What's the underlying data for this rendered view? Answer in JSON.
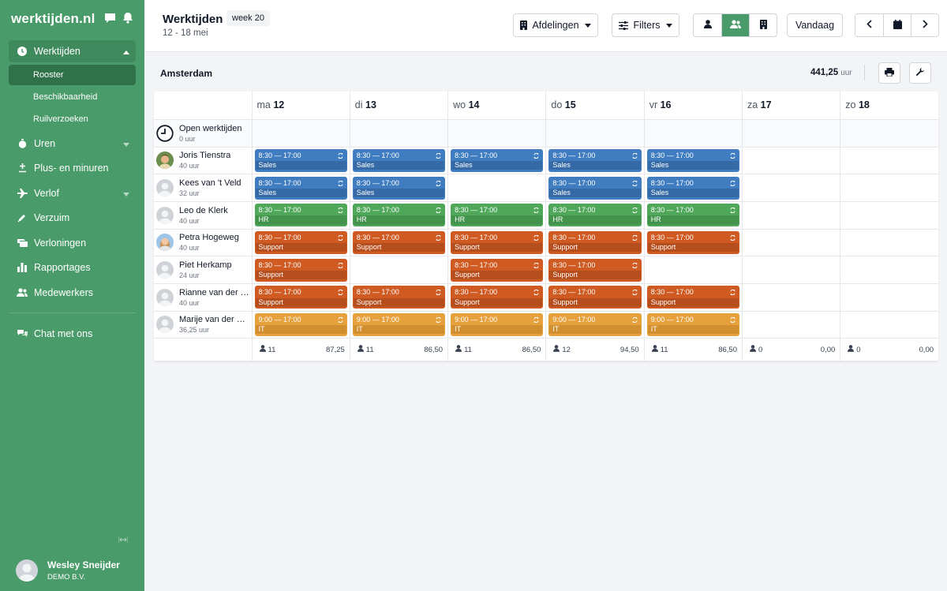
{
  "app": {
    "logo": "werktijden.nl",
    "user": {
      "name": "Wesley Sneijder",
      "company": "DEMO B.V."
    }
  },
  "sidebar": {
    "items": [
      {
        "label": "Werktijden",
        "icon": "clock-icon",
        "active": true,
        "expanded": true
      },
      {
        "label": "Uren",
        "icon": "stopwatch-icon",
        "dropdown": true
      },
      {
        "label": "Plus- en minuren",
        "icon": "plus-minus-icon"
      },
      {
        "label": "Verlof",
        "icon": "plane-icon",
        "dropdown": true
      },
      {
        "label": "Verzuim",
        "icon": "thermometer-icon"
      },
      {
        "label": "Verloningen",
        "icon": "money-icon"
      },
      {
        "label": "Rapportages",
        "icon": "bar-chart-icon"
      },
      {
        "label": "Medewerkers",
        "icon": "users-icon"
      }
    ],
    "sub_items": [
      {
        "label": "Rooster",
        "active": true
      },
      {
        "label": "Beschikbaarheid"
      },
      {
        "label": "Ruilverzoeken"
      }
    ],
    "chat": {
      "label": "Chat met ons",
      "icon": "chat-icon"
    }
  },
  "header": {
    "title": "Werktijden",
    "week": "week 20",
    "range": "12 - 18 mei",
    "departments_label": "Afdelingen",
    "filters_label": "Filters",
    "today_label": "Vandaag"
  },
  "schedule": {
    "location": "Amsterdam",
    "total_hours": "441,25",
    "total_unit": "uur",
    "days": [
      {
        "prefix": "ma",
        "num": "12"
      },
      {
        "prefix": "di",
        "num": "13"
      },
      {
        "prefix": "wo",
        "num": "14"
      },
      {
        "prefix": "do",
        "num": "15"
      },
      {
        "prefix": "vr",
        "num": "16"
      },
      {
        "prefix": "za",
        "num": "17"
      },
      {
        "prefix": "zo",
        "num": "18"
      }
    ],
    "open": {
      "label": "Open werktijden",
      "hours": "0 uur"
    },
    "employees": [
      {
        "name": "Joris Tienstra",
        "hours": "40 uur",
        "avatar": "photo-male",
        "shifts": [
          {
            "time": "8:30 — 17:00",
            "dept": "Sales",
            "color": "sales"
          },
          {
            "time": "8:30 — 17:00",
            "dept": "Sales",
            "color": "sales"
          },
          {
            "time": "8:30 — 17:00",
            "dept": "Sales",
            "color": "sales"
          },
          {
            "time": "8:30 — 17:00",
            "dept": "Sales",
            "color": "sales"
          },
          {
            "time": "8:30 — 17:00",
            "dept": "Sales",
            "color": "sales"
          },
          null,
          null
        ]
      },
      {
        "name": "Kees van 't Veld",
        "hours": "32 uur",
        "avatar": "default",
        "shifts": [
          {
            "time": "8:30 — 17:00",
            "dept": "Sales",
            "color": "sales"
          },
          {
            "time": "8:30 — 17:00",
            "dept": "Sales",
            "color": "sales"
          },
          null,
          {
            "time": "8:30 — 17:00",
            "dept": "Sales",
            "color": "sales"
          },
          {
            "time": "8:30 — 17:00",
            "dept": "Sales",
            "color": "sales"
          },
          null,
          null
        ]
      },
      {
        "name": "Leo de Klerk",
        "hours": "40 uur",
        "avatar": "default",
        "shifts": [
          {
            "time": "8:30 — 17:00",
            "dept": "HR",
            "color": "hr"
          },
          {
            "time": "8:30 — 17:00",
            "dept": "HR",
            "color": "hr"
          },
          {
            "time": "8:30 — 17:00",
            "dept": "HR",
            "color": "hr"
          },
          {
            "time": "8:30 — 17:00",
            "dept": "HR",
            "color": "hr"
          },
          {
            "time": "8:30 — 17:00",
            "dept": "HR",
            "color": "hr"
          },
          null,
          null
        ]
      },
      {
        "name": "Petra Hogeweg",
        "hours": "40 uur",
        "avatar": "photo-female",
        "shifts": [
          {
            "time": "8:30 — 17:00",
            "dept": "Support",
            "color": "support"
          },
          {
            "time": "8:30 — 17:00",
            "dept": "Support",
            "color": "support"
          },
          {
            "time": "8:30 — 17:00",
            "dept": "Support",
            "color": "support"
          },
          {
            "time": "8:30 — 17:00",
            "dept": "Support",
            "color": "support"
          },
          {
            "time": "8:30 — 17:00",
            "dept": "Support",
            "color": "support"
          },
          null,
          null
        ]
      },
      {
        "name": "Piet Herkamp",
        "hours": "24 uur",
        "avatar": "default",
        "shifts": [
          {
            "time": "8:30 — 17:00",
            "dept": "Support",
            "color": "support"
          },
          null,
          {
            "time": "8:30 — 17:00",
            "dept": "Support",
            "color": "support"
          },
          {
            "time": "8:30 — 17:00",
            "dept": "Support",
            "color": "support"
          },
          null,
          null,
          null
        ]
      },
      {
        "name": "Rianne van der H...",
        "hours": "40 uur",
        "avatar": "default",
        "shifts": [
          {
            "time": "8:30 — 17:00",
            "dept": "Support",
            "color": "support"
          },
          {
            "time": "8:30 — 17:00",
            "dept": "Support",
            "color": "support"
          },
          {
            "time": "8:30 — 17:00",
            "dept": "Support",
            "color": "support"
          },
          {
            "time": "8:30 — 17:00",
            "dept": "Support",
            "color": "support"
          },
          {
            "time": "8:30 — 17:00",
            "dept": "Support",
            "color": "support"
          },
          null,
          null
        ]
      },
      {
        "name": "Marije van der Za...",
        "hours": "36,25 uur",
        "avatar": "default",
        "shifts": [
          {
            "time": "9:00 — 17:00",
            "dept": "IT",
            "color": "it"
          },
          {
            "time": "9:00 — 17:00",
            "dept": "IT",
            "color": "it"
          },
          {
            "time": "9:00 — 17:00",
            "dept": "IT",
            "color": "it"
          },
          {
            "time": "9:00 — 17:00",
            "dept": "IT",
            "color": "it"
          },
          {
            "time": "9:00 — 17:00",
            "dept": "IT",
            "color": "it"
          },
          null,
          null
        ]
      }
    ],
    "totals": [
      {
        "count": "11",
        "hours": "87,25"
      },
      {
        "count": "11",
        "hours": "86,50"
      },
      {
        "count": "11",
        "hours": "86,50"
      },
      {
        "count": "12",
        "hours": "94,50"
      },
      {
        "count": "11",
        "hours": "86,50"
      },
      {
        "count": "0",
        "hours": "0,00"
      },
      {
        "count": "0",
        "hours": "0,00"
      }
    ]
  },
  "colors": {
    "sidebar": "#4a9b6a",
    "sales": "#3f7cc0",
    "hr": "#4fa75a",
    "support": "#cf5a22",
    "it": "#e7a13c"
  }
}
